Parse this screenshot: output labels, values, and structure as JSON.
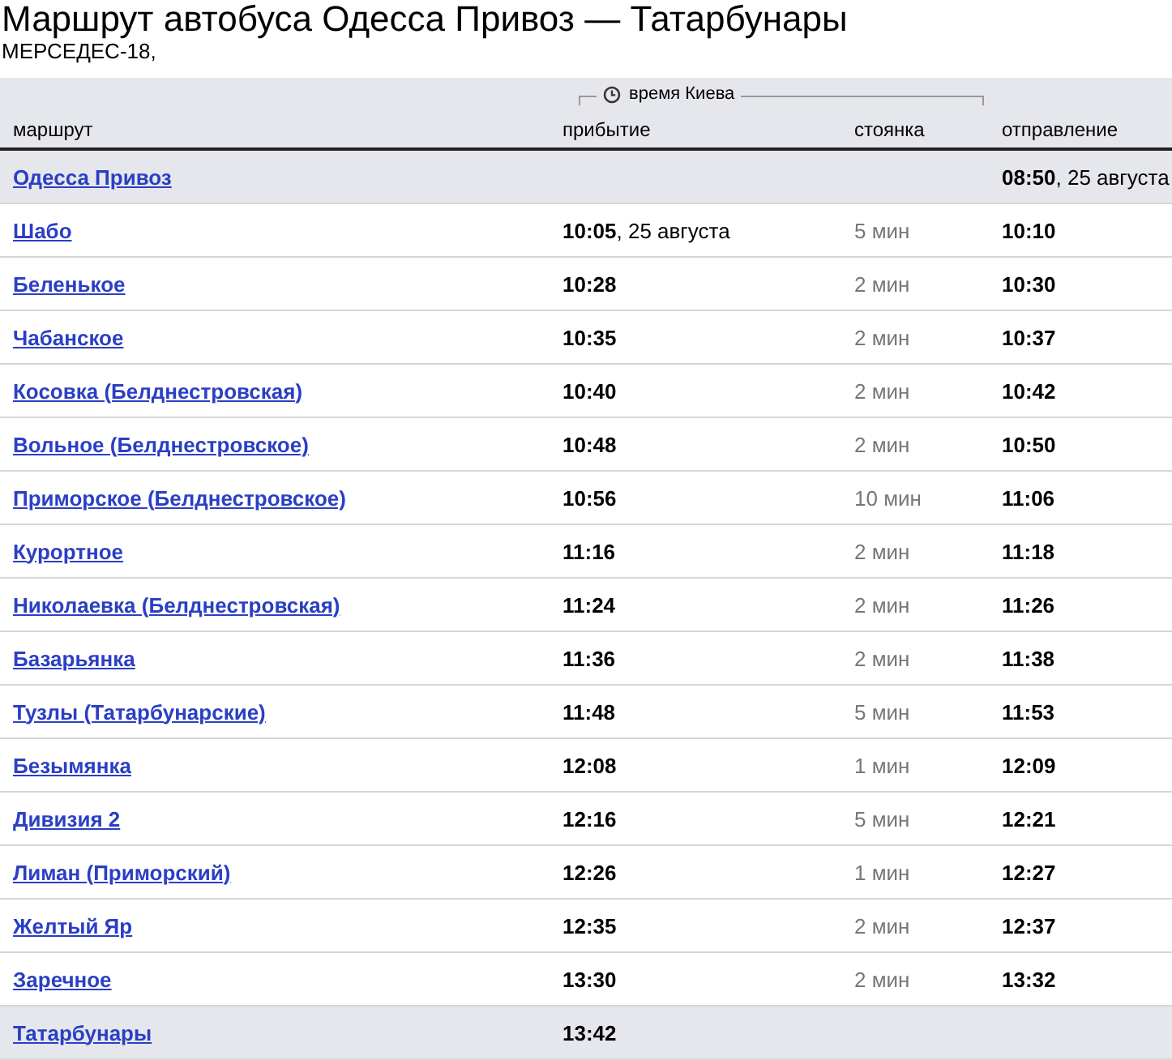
{
  "title": "Маршрут автобуса Одесса Привоз — Татарбунары",
  "subtitle": "МЕРСЕДЕС-18,",
  "timezone_label": "время Киева",
  "columns": [
    "маршрут",
    "прибытие",
    "стоянка",
    "отправление"
  ],
  "rows": [
    {
      "kind": "terminal",
      "station": "Одесса Привоз",
      "departure": {
        "time": "08:50",
        "date": ", 25 августа"
      }
    },
    {
      "kind": "stop",
      "station": "Шабо",
      "arrival": {
        "time": "10:05",
        "date": ", 25 августа"
      },
      "stop": "5 мин",
      "departure": {
        "time": "10:10"
      }
    },
    {
      "kind": "stop",
      "station": "Беленькое",
      "arrival": {
        "time": "10:28"
      },
      "stop": "2 мин",
      "departure": {
        "time": "10:30"
      }
    },
    {
      "kind": "stop",
      "station": "Чабанское",
      "arrival": {
        "time": "10:35"
      },
      "stop": "2 мин",
      "departure": {
        "time": "10:37"
      }
    },
    {
      "kind": "stop",
      "station": "Косовка (Белднестровская)",
      "arrival": {
        "time": "10:40"
      },
      "stop": "2 мин",
      "departure": {
        "time": "10:42"
      }
    },
    {
      "kind": "stop",
      "station": "Вольное (Белднестровское)",
      "arrival": {
        "time": "10:48"
      },
      "stop": "2 мин",
      "departure": {
        "time": "10:50"
      }
    },
    {
      "kind": "stop",
      "station": "Приморское (Белднестровское)",
      "arrival": {
        "time": "10:56"
      },
      "stop": "10 мин",
      "departure": {
        "time": "11:06"
      }
    },
    {
      "kind": "stop",
      "station": "Курортное",
      "arrival": {
        "time": "11:16"
      },
      "stop": "2 мин",
      "departure": {
        "time": "11:18"
      }
    },
    {
      "kind": "stop",
      "station": "Николаевка (Белднестровская)",
      "arrival": {
        "time": "11:24"
      },
      "stop": "2 мин",
      "departure": {
        "time": "11:26"
      }
    },
    {
      "kind": "stop",
      "station": "Базарьянка",
      "arrival": {
        "time": "11:36"
      },
      "stop": "2 мин",
      "departure": {
        "time": "11:38"
      }
    },
    {
      "kind": "stop",
      "station": "Тузлы (Татарбунарские)",
      "arrival": {
        "time": "11:48"
      },
      "stop": "5 мин",
      "departure": {
        "time": "11:53"
      }
    },
    {
      "kind": "stop",
      "station": "Безымянка",
      "arrival": {
        "time": "12:08"
      },
      "stop": "1 мин",
      "departure": {
        "time": "12:09"
      }
    },
    {
      "kind": "stop",
      "station": "Дивизия 2",
      "arrival": {
        "time": "12:16"
      },
      "stop": "5 мин",
      "departure": {
        "time": "12:21"
      }
    },
    {
      "kind": "stop",
      "station": "Лиман (Приморский)",
      "arrival": {
        "time": "12:26"
      },
      "stop": "1 мин",
      "departure": {
        "time": "12:27"
      }
    },
    {
      "kind": "stop",
      "station": "Желтый Яр",
      "arrival": {
        "time": "12:35"
      },
      "stop": "2 мин",
      "departure": {
        "time": "12:37"
      }
    },
    {
      "kind": "stop",
      "station": "Заречное",
      "arrival": {
        "time": "13:30"
      },
      "stop": "2 мин",
      "departure": {
        "time": "13:32"
      }
    },
    {
      "kind": "terminal",
      "station": "Татарбунары",
      "arrival": {
        "time": "13:42"
      }
    }
  ]
}
